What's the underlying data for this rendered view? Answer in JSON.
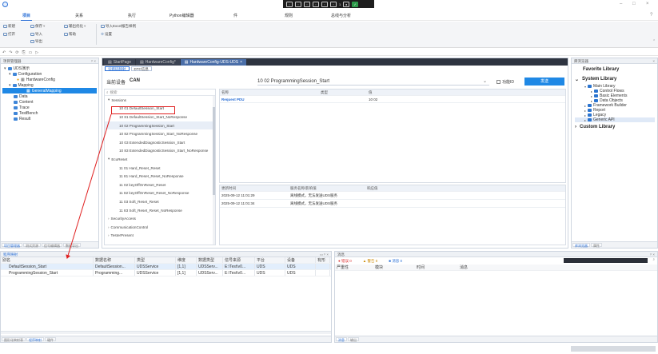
{
  "menu": {
    "items": [
      "项目",
      "关系",
      "执行",
      "Python编辑器",
      "件",
      "规则",
      "总线与分析"
    ]
  },
  "ribbon": {
    "new": "新建",
    "open": "打开",
    "save": "保存",
    "import": "导入",
    "export": "导出",
    "other": "输出优化",
    "help": "帮助",
    "import_excel": "导入Excel报告样例",
    "settings": "设置"
  },
  "floatbar": {
    "items": [
      "1"
    ]
  },
  "project_manager": {
    "title": "项目管理器",
    "tree": [
      {
        "label": "UDS演示",
        "level": 0
      },
      {
        "label": "Configuration",
        "level": 1
      },
      {
        "label": "HardwareConfig",
        "level": 2
      },
      {
        "label": "Mapping",
        "level": 1
      },
      {
        "label": "GeneralMapping",
        "level": 2,
        "selected": true
      },
      {
        "label": "Data",
        "level": 1
      },
      {
        "label": "Content",
        "level": 1
      },
      {
        "label": "Trace",
        "level": 1
      },
      {
        "label": "TestBench",
        "level": 1
      },
      {
        "label": "Result",
        "level": 1
      }
    ],
    "bottom_tabs": [
      "项目管理器",
      "测试资源",
      "信号编辑器",
      "数据导出"
    ]
  },
  "doc_tabs": [
    {
      "label": "StartPage"
    },
    {
      "label": "HardwareConfig*"
    },
    {
      "label": "HardwareConfig-UDS-UDS",
      "active": true
    }
  ],
  "sub_tabs": [
    "诊断码映射",
    "DTC信息"
  ],
  "device": {
    "label": "当前设备",
    "value": "CAN"
  },
  "session_select": {
    "value": "10 02 ProgrammingSession_Start",
    "checkbox_label": "功能ID",
    "send_label": "发送"
  },
  "search": {
    "placeholder": "搜索"
  },
  "services": [
    {
      "label": "Sessions",
      "group": true
    },
    {
      "label": "10 01 DefaultSession_Start",
      "highlight": true
    },
    {
      "label": "10 81 DefaultSession_Start_NoResponse"
    },
    {
      "label": "10 02 ProgrammingSession_Start",
      "selected": true
    },
    {
      "label": "10 82 ProgrammingSession_Start_NoResponse"
    },
    {
      "label": "10 03 ExtendedDiagnosticSession_Start"
    },
    {
      "label": "10 83 ExtendedDiagnosticSession_Start_NoResponse"
    },
    {
      "label": "EcuReset",
      "group": true
    },
    {
      "label": "11 01 Hard_Reset_Reset"
    },
    {
      "label": "11 81 Hard_Reset_Reset_NoResponse"
    },
    {
      "label": "11 02 keyOffOnReset_Reset"
    },
    {
      "label": "11 82 keyOffOnReset_Reset_NoResponse"
    },
    {
      "label": "11 03 Soft_Reset_Reset"
    },
    {
      "label": "11 83 Soft_Reset_Reset_NoResponse"
    },
    {
      "label": "SecurityAccess",
      "group": true
    },
    {
      "label": "CommunicationControl",
      "group": true
    },
    {
      "label": "TesterPresent",
      "group": true
    }
  ],
  "param_table": {
    "headers": [
      "名称",
      "类型",
      "值"
    ],
    "rows": [
      {
        "name": "Request PDU",
        "type": "",
        "value": "10 02"
      }
    ]
  },
  "log_table": {
    "headers": [
      "更新时间",
      "服务名称/影响值",
      "响应值"
    ],
    "rows": [
      {
        "time": "2025-09-12 11:01:29",
        "service": "离线模式，无法发送UDS服务",
        "resp": ""
      },
      {
        "time": "2025-09-12 11:01:34",
        "service": "离线模式，无法发送UDS服务",
        "resp": ""
      }
    ]
  },
  "library": {
    "title": "库浏览器",
    "favorite": "Favorite Library",
    "system": "System Library",
    "items": [
      {
        "label": "Main Library",
        "level": 1
      },
      {
        "label": "Control Flows",
        "level": 2
      },
      {
        "label": "Basic Elements",
        "level": 2
      },
      {
        "label": "Data Objects",
        "level": 2
      },
      {
        "label": "Framework Builder",
        "level": 1
      },
      {
        "label": "Report",
        "level": 1
      },
      {
        "label": "Legacy",
        "level": 1
      },
      {
        "label": "Generic API",
        "level": 1,
        "selected": true
      }
    ],
    "custom": "Custom Library",
    "bottom_tabs": [
      "库浏览器",
      "属性"
    ]
  },
  "mapping": {
    "title": "程序映射",
    "headers": [
      "别名",
      "数据名称",
      "类型",
      "维度",
      "数据类型",
      "信号来源",
      "平台",
      "设备",
      "有形"
    ],
    "rows": [
      {
        "alias": "DefaultSession_Start",
        "name": "DefaultSession...",
        "type": "UDSService",
        "dim": "[1,1]",
        "dtype": "UDSServ...",
        "src": "E:\\Test\\v0...",
        "plat": "UDS",
        "dev": "UDS",
        "selected": true
      },
      {
        "alias": "ProgrammingSession_Start",
        "name": "Programming...",
        "type": "UDSService",
        "dim": "[1,1]",
        "dtype": "UDSServ...",
        "src": "E:\\Test\\v0...",
        "plat": "UDS",
        "dev": "UDS"
      }
    ],
    "bottom_tabs": [
      "图形化映射表",
      "程序映射",
      "硬件"
    ]
  },
  "messages": {
    "title": "消息",
    "errors": "错误 0",
    "warnings": "警告 0",
    "infos": "消息 0",
    "headers": [
      "严重性",
      "模块",
      "时间",
      "消息"
    ],
    "bottom_tabs": [
      "消息",
      "输出"
    ]
  },
  "colors": {
    "accent": "#1f88e5",
    "tab_active": "#4a6ea8",
    "highlight_box": "#e02020",
    "arrow": "#e02020"
  }
}
